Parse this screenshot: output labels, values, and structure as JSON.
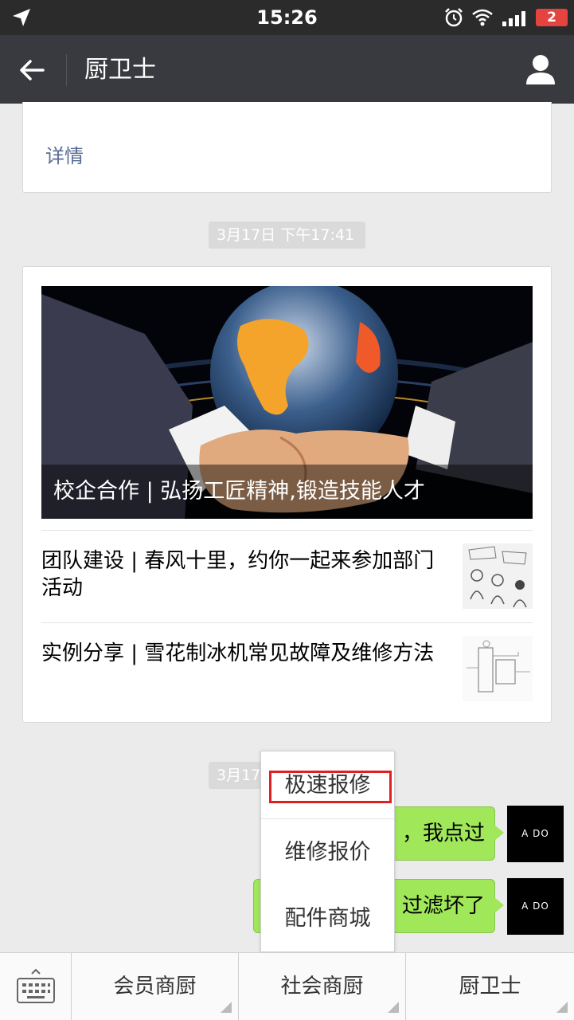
{
  "status_bar": {
    "time": "15:26",
    "battery": "2",
    "icons": [
      "location-arrow-icon",
      "alarm-icon",
      "wifi-icon",
      "signal-icon",
      "battery-icon"
    ]
  },
  "header": {
    "title": "厨卫士",
    "icons": [
      "back-arrow-icon",
      "user-profile-icon"
    ]
  },
  "top_card": {
    "detail_link": "详情"
  },
  "timestamps": [
    "3月17日 下午17:41",
    "3月17"
  ],
  "news_card": {
    "cover_title": "校企合作 | 弘扬工匠精神,锻造技能人才",
    "items": [
      {
        "title": "团队建设 | 春风十里，约你一起来参加部门活动"
      },
      {
        "title": "实例分享 | 雪花制冰机常见故障及维修方法"
      }
    ]
  },
  "messages": [
    {
      "text": "，我点过",
      "avatar_text": "A DO"
    },
    {
      "text": "过滤坏了",
      "avatar_text": "A DO"
    }
  ],
  "popup_menu": {
    "items": [
      "极速报修",
      "维修报价",
      "配件商城"
    ]
  },
  "bottom_menu": {
    "items": [
      "会员商厨",
      "社会商厨",
      "厨卫士"
    ],
    "keyboard_icon": "keyboard-icon"
  },
  "colors": {
    "status_bar": "#2b2b2b",
    "title_bar": "#393a3f",
    "link": "#576b95",
    "bubble": "#a0e75a",
    "highlight": "#e01f25"
  }
}
